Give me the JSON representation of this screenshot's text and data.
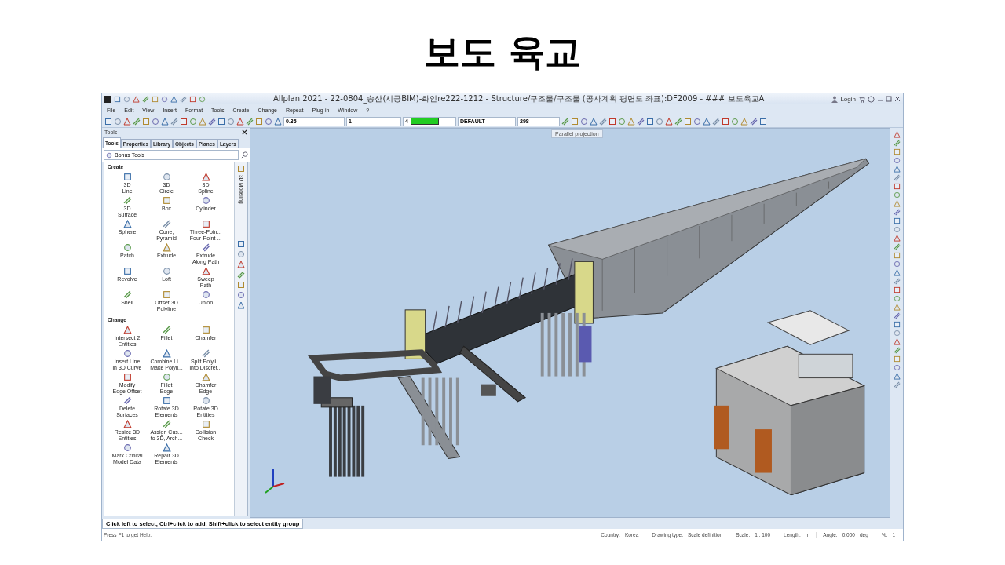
{
  "slide_title": "보도 육교",
  "window": {
    "title": "Allplan 2021 - 22-0804_송산(시공BIM)-화인re222-1212 - Structure/구조물/구조물 (공사계획 평면도 좌표):DF2009 - ### 보도육교A",
    "login": "Login"
  },
  "menu": [
    "File",
    "Edit",
    "View",
    "Insert",
    "Format",
    "Tools",
    "Create",
    "Change",
    "Repeat",
    "Plug-in",
    "Window",
    "?"
  ],
  "toolbar": {
    "pen": "0.35",
    "line": "1",
    "color_number": "4",
    "color": "#22cc22",
    "layer": "DEFAULT",
    "fill": "298"
  },
  "tools_panel": {
    "title": "Tools",
    "palette": "Bonus Tools",
    "side_tab": "3D Modeling",
    "tabs": [
      {
        "label": "Tools",
        "selected": true
      },
      {
        "label": "Properties",
        "selected": false
      },
      {
        "label": "Library",
        "selected": false
      },
      {
        "label": "Objects",
        "selected": false
      },
      {
        "label": "Planes",
        "selected": false
      },
      {
        "label": "Layers",
        "selected": false
      }
    ],
    "sections": [
      {
        "title": "Create",
        "items": [
          "3D\nLine",
          "3D\nCircle",
          "3D\nSpline",
          "3D\nSurface",
          "Box",
          "Cylinder",
          "Sphere",
          "Cone,\nPyramid",
          "Three-Poin...\nFour-Point ...",
          "Patch",
          "Extrude",
          "Extrude\nAlong Path",
          "Revolve",
          "Loft",
          "Sweep\nPath",
          "Shell",
          "Offset 3D\nPolyline",
          "Union"
        ]
      },
      {
        "title": "Change",
        "items": [
          "Intersect 2\nEntities",
          "Fillet",
          "Chamfer",
          "Insert Line\nin 3D Curve",
          "Combine Li...\nMake Polyli...",
          "Split Polyli...\ninto Discret...",
          "Modify\nEdge Offset",
          "Fillet\nEdge",
          "Chamfer\nEdge",
          "Delete\nSurfaces",
          "Rotate 3D\nElements",
          "Rotate 3D\nEntities",
          "Resize 3D\nEntities",
          "Assign Cus...\nto 3D, Arch...",
          "Collision\nCheck",
          "Mark Critical\nModel Data",
          "Repair 3D\nElements"
        ]
      }
    ]
  },
  "viewport": {
    "tooltip": "Parallel projection"
  },
  "prompt": "Click left to select, Ctrl+click to add, Shift+click to select entity group",
  "status_bar": {
    "help": "Press F1 to get Help.",
    "fields": [
      {
        "label": "Country:",
        "value": "Korea"
      },
      {
        "label": "Drawing type:",
        "value": "Scale definition"
      },
      {
        "label": "Scale:",
        "value": "1 : 100"
      },
      {
        "label": "Length:",
        "value": "m"
      },
      {
        "label": "Angle:",
        "value": "0.000",
        "unit": "deg"
      },
      {
        "label": "%:",
        "value": "1"
      }
    ]
  }
}
